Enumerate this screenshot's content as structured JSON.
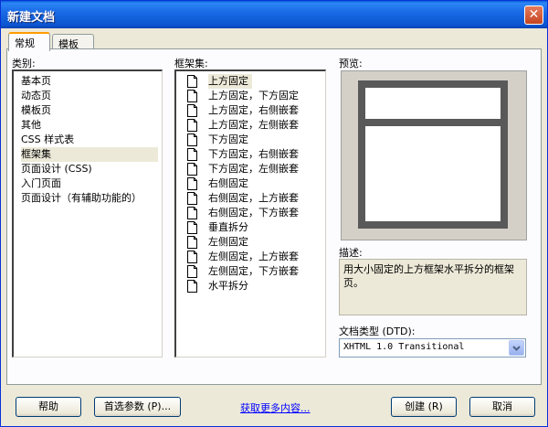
{
  "window": {
    "title": "新建文档",
    "close": "✕"
  },
  "tabs": [
    {
      "label": "常规",
      "active": true
    },
    {
      "label": "模板",
      "active": false
    }
  ],
  "category": {
    "label": "类别:",
    "items": [
      "基本页",
      "动态页",
      "模板页",
      "其他",
      "CSS 样式表",
      "框架集",
      "页面设计 (CSS)",
      "入门页面",
      "页面设计（有辅助功能的）"
    ],
    "selected_index": 5
  },
  "frameset": {
    "label": "框架集:",
    "items": [
      "上方固定",
      "上方固定，下方固定",
      "上方固定，右侧嵌套",
      "上方固定，左侧嵌套",
      "下方固定",
      "下方固定，右侧嵌套",
      "下方固定，左侧嵌套",
      "右侧固定",
      "右侧固定，上方嵌套",
      "右侧固定，下方嵌套",
      "垂直拆分",
      "左侧固定",
      "左侧固定，上方嵌套",
      "左侧固定，下方嵌套",
      "水平拆分"
    ],
    "selected_index": 0
  },
  "preview": {
    "label": "预览:"
  },
  "description": {
    "label": "描述:",
    "text": "用大小固定的上方框架水平拆分的框架页。"
  },
  "doctype": {
    "label": "文档类型 (DTD):",
    "value": "XHTML 1.0 Transitional"
  },
  "buttons": {
    "help": "帮助",
    "preferences": "首选参数 (P)...",
    "more_content": "获取更多内容...",
    "create": "创建 (R)",
    "cancel": "取消"
  }
}
